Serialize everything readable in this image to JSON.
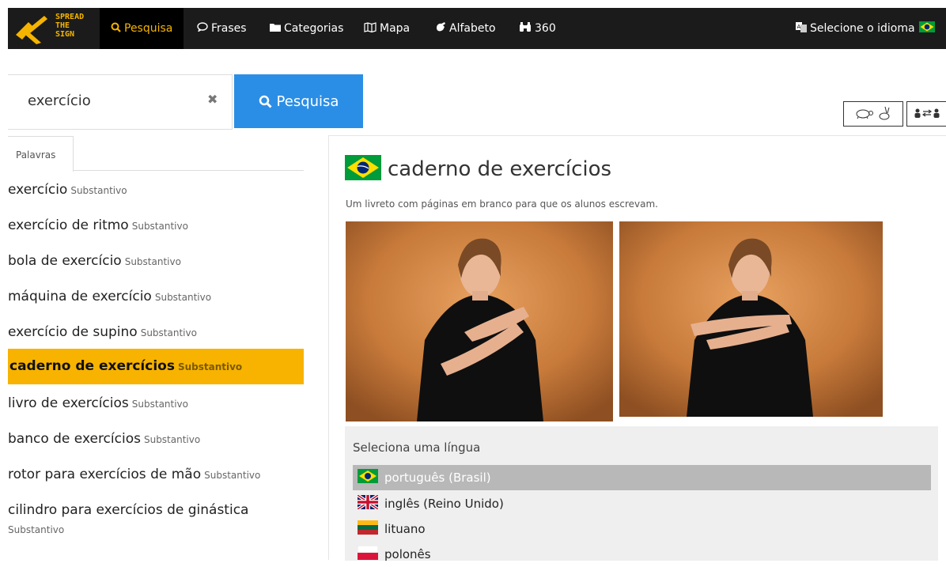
{
  "nav": {
    "logo_lines": [
      "SPREAD",
      "THE",
      "SIGN"
    ],
    "items": [
      {
        "label": "Pesquisa",
        "icon": "search-icon"
      },
      {
        "label": "Frases",
        "icon": "speech-bubble-icon"
      },
      {
        "label": "Categorias",
        "icon": "folder-icon"
      },
      {
        "label": "Mapa",
        "icon": "map-icon"
      },
      {
        "label": "Alfabeto",
        "icon": "hand-icon"
      },
      {
        "label": "360",
        "icon": "binoculars-icon"
      }
    ],
    "language_selector": "Selecione o idioma"
  },
  "search": {
    "value": "exercício",
    "button_label": "Pesquisa"
  },
  "results": {
    "tab_label": "Palavras",
    "items": [
      {
        "word": "exercício",
        "pos": "Substantivo"
      },
      {
        "word": "exercício de ritmo",
        "pos": "Substantivo"
      },
      {
        "word": "bola de exercício",
        "pos": "Substantivo"
      },
      {
        "word": "máquina de exercício",
        "pos": "Substantivo"
      },
      {
        "word": "exercício de supino",
        "pos": "Substantivo"
      },
      {
        "word": "caderno de exercícios",
        "pos": "Substantivo"
      },
      {
        "word": "livro de exercícios",
        "pos": "Substantivo"
      },
      {
        "word": "banco de exercícios",
        "pos": "Substantivo"
      },
      {
        "word": "rotor para exercícios de mão",
        "pos": "Substantivo"
      },
      {
        "word": "cilindro para exercícios de ginástica",
        "pos": "Substantivo"
      }
    ],
    "selected_index": 5
  },
  "detail": {
    "title": "caderno de exercícios",
    "description": "Um livreto com páginas em branco para que os alunos escrevam."
  },
  "languages": {
    "title": "Seleciona uma língua",
    "items": [
      {
        "label": "português (Brasil)",
        "flag": "brazil-flag-icon"
      },
      {
        "label": "inglês (Reino Unido)",
        "flag": "uk-flag-icon"
      },
      {
        "label": "lituano",
        "flag": "lithuania-flag-icon"
      },
      {
        "label": "polonês",
        "flag": "poland-flag-icon"
      }
    ],
    "selected_index": 0
  },
  "colors": {
    "accent": "#f7b300",
    "search_button": "#2b8ee6",
    "nav_bg": "#1b1b1b"
  }
}
